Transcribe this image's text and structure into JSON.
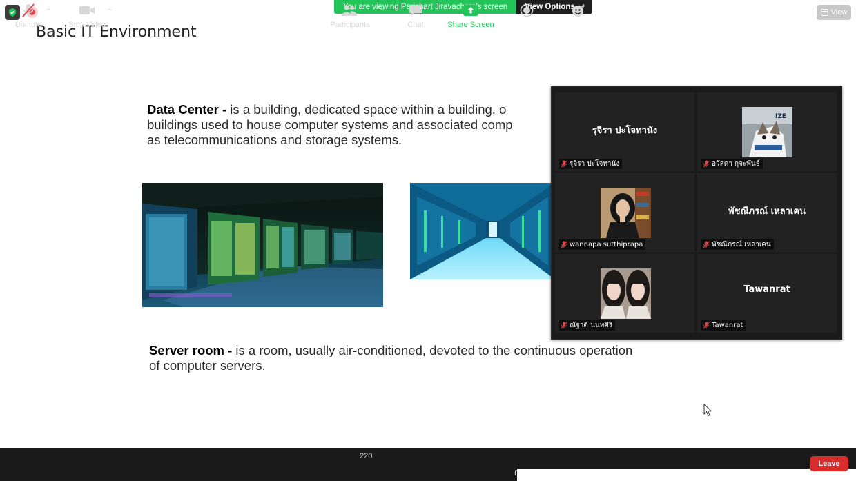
{
  "banner": {
    "message": "You are viewing Parichart Jiravachara's screen",
    "options_label": "View Options"
  },
  "view_button": "View",
  "slide": {
    "title": "Basic IT Environment",
    "data_center_term": "Data Center -",
    "data_center_line1": " is a building, dedicated space within a building, o",
    "data_center_line2": "buildings used to house computer systems and associated comp",
    "data_center_line3": "as telecommunications and storage systems.",
    "server_room_term": "Server room -",
    "server_room_line1": " is a room, usually air-conditioned, devoted to the continuous operation",
    "server_room_line2": "of computer servers."
  },
  "participants": [
    {
      "big_name": "รุจิรา ปะโจทานัง",
      "label": "รุจิรา ปะโจทานัง",
      "video": false
    },
    {
      "big_name": "",
      "label": "อวัสดา กุจะพันธ์",
      "video": true,
      "picture": "cat-photo"
    },
    {
      "big_name": "",
      "label": "wannapa sutthiprapa",
      "video": true,
      "picture": "woman-photo"
    },
    {
      "big_name": "พัชณีภรณ์ เหลาเคน",
      "label": "พัชณีภรณ์ เหลาเคน",
      "video": false
    },
    {
      "big_name": "",
      "label": "ณัฐาดี นนทศิริ",
      "video": true,
      "picture": "two-girls-photo"
    },
    {
      "big_name": "Tawanrat",
      "label": "Tawanrat",
      "video": false
    }
  ],
  "toolbar": {
    "unmute": "Unmute",
    "stop_video": "Stop Video",
    "participants": "Participants",
    "participant_count": "220",
    "chat": "Chat",
    "share_screen": "Share Screen",
    "record_partial": "R",
    "leave": "Leave"
  },
  "colors": {
    "banner_green": "#23c55b",
    "share_green": "#23c55b",
    "leave_red": "#d92d2d",
    "toolbar_bg": "#1a1a1a"
  }
}
